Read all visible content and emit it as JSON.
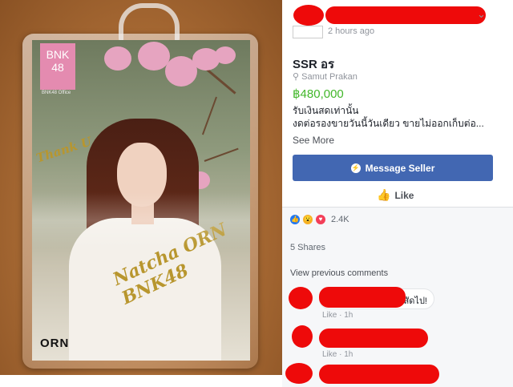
{
  "photo": {
    "logo_text": "BNK\n48",
    "logo_sub": "BNK48 Office",
    "thanks_text": "Thank U",
    "signature_text": "Natcha ORN BNK48",
    "card_name": "ORN"
  },
  "listing": {
    "posted_time": "2 hours ago",
    "title": "SSR อร",
    "location": "Samut Prakan",
    "price": "฿480,000",
    "description_line1": "รับเงินสดเท่านั้น",
    "description_line2": "งดต่อรองขายวันนี้วันเดียว ขายไม่ออกเก็บต่อ...",
    "see_more": "See More",
    "message_button": "Message Seller",
    "like_label": "Like"
  },
  "engagement": {
    "reaction_count": "2.4K",
    "shares": "5 Shares",
    "view_previous": "View previous comments"
  },
  "comments": [
    {
      "visible_text": "สัดไป!",
      "like": "Like",
      "time": "1h"
    },
    {
      "visible_text": "",
      "like": "Like",
      "time": "1h"
    }
  ],
  "colors": {
    "redaction": "#ee0a0a",
    "price": "#42b72a",
    "button": "#4267b2"
  }
}
